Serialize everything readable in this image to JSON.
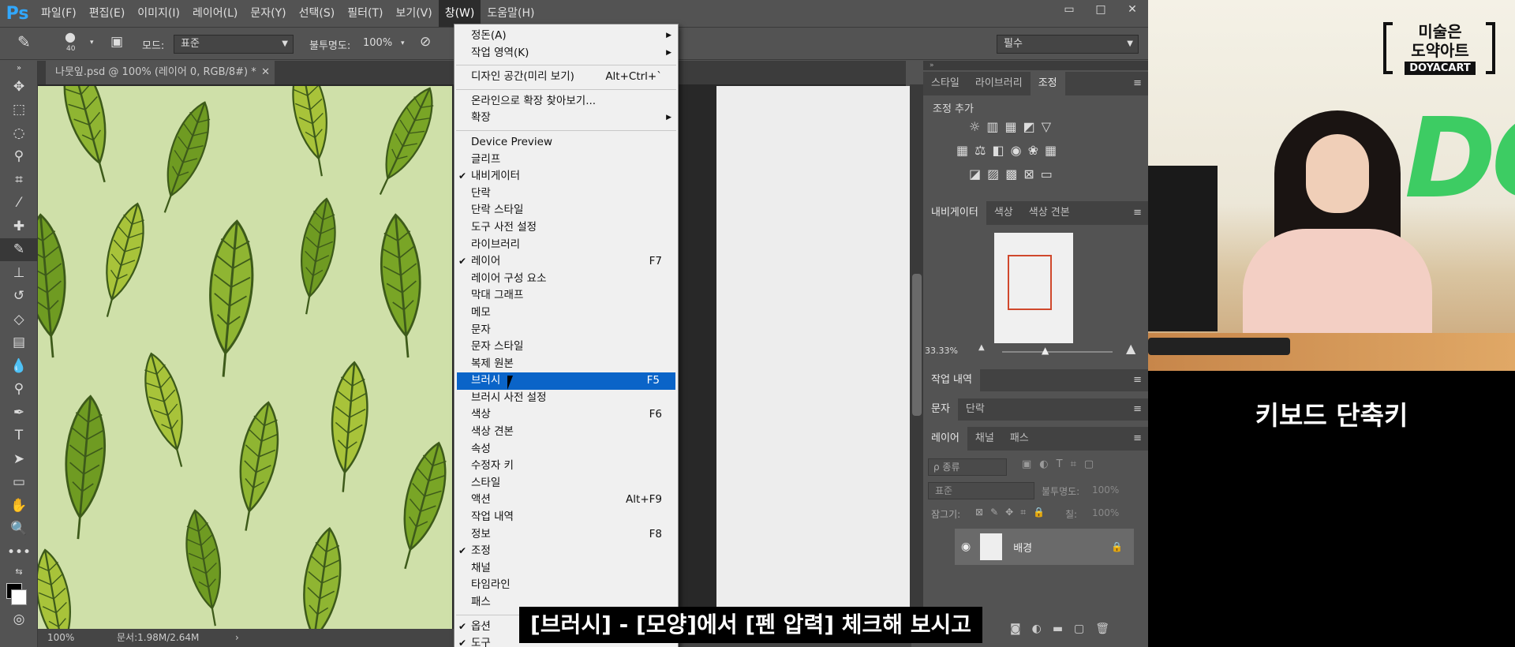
{
  "menubar": {
    "logo": "Ps",
    "items": [
      "파일(F)",
      "편집(E)",
      "이미지(I)",
      "레이어(L)",
      "문자(Y)",
      "선택(S)",
      "필터(T)",
      "보기(V)",
      "창(W)",
      "도움말(H)"
    ],
    "active_index": 8,
    "win_buttons": [
      "▭",
      "□",
      "✕"
    ]
  },
  "options": {
    "brush_size": "40",
    "mode_label": "모드:",
    "mode_value": "표준",
    "opacity_label": "불투명도:",
    "opacity_value": "100%",
    "workspace": "필수"
  },
  "document_tab": {
    "title": "나뭇잎.psd @ 100% (레이어 0, RGB/8#) *",
    "close": "✕"
  },
  "window_menu": {
    "items": [
      {
        "label": "정돈(A)",
        "submenu": true
      },
      {
        "label": "작업 영역(K)",
        "submenu": true
      },
      {
        "separator": true
      },
      {
        "label": "디자인 공간(미리 보기)",
        "shortcut": "Alt+Ctrl+`"
      },
      {
        "separator": true
      },
      {
        "label": "온라인으로 확장 찾아보기..."
      },
      {
        "label": "확장",
        "submenu": true
      },
      {
        "separator": true
      },
      {
        "label": "Device Preview"
      },
      {
        "label": "글리프"
      },
      {
        "label": "내비게이터",
        "checked": true
      },
      {
        "label": "단락"
      },
      {
        "label": "단락 스타일"
      },
      {
        "label": "도구 사전 설정"
      },
      {
        "label": "라이브러리"
      },
      {
        "label": "레이어",
        "checked": true,
        "shortcut": "F7"
      },
      {
        "label": "레이어 구성 요소"
      },
      {
        "label": "막대 그래프"
      },
      {
        "label": "메모"
      },
      {
        "label": "문자"
      },
      {
        "label": "문자 스타일"
      },
      {
        "label": "복제 원본"
      },
      {
        "label": "브러시",
        "shortcut": "F5",
        "highlighted": true
      },
      {
        "label": "브러시 사전 설정"
      },
      {
        "label": "색상",
        "shortcut": "F6"
      },
      {
        "label": "색상 견본"
      },
      {
        "label": "속성"
      },
      {
        "label": "수정자 키"
      },
      {
        "label": "스타일"
      },
      {
        "label": "액션",
        "shortcut": "Alt+F9"
      },
      {
        "label": "작업 내역"
      },
      {
        "label": "정보",
        "shortcut": "F8"
      },
      {
        "label": "조정",
        "checked": true
      },
      {
        "label": "채널"
      },
      {
        "label": "타임라인"
      },
      {
        "label": "패스"
      },
      {
        "separator": true
      },
      {
        "label": "옵션",
        "checked": true
      },
      {
        "label": "도구",
        "checked": true
      }
    ]
  },
  "status": {
    "zoom": "100%",
    "doc": "문서:1.98M/2.64M"
  },
  "panels": {
    "top_tabs": [
      "스타일",
      "라이브러리",
      "조정"
    ],
    "adj_title": "조정 추가",
    "nav_tabs": [
      "내비게이터",
      "색상",
      "색상 견본"
    ],
    "nav_zoom": "33.33%",
    "history_tab": "작업 내역",
    "type_tabs": [
      "문자",
      "단락"
    ],
    "layer_tabs": [
      "레이어",
      "채널",
      "패스"
    ],
    "layer_kind": "ρ 종류",
    "blend_mode": "표준",
    "opacity_label": "불투명도:",
    "opacity_value": "100%",
    "lock_label": "잠그기:",
    "fill_label": "칠:",
    "fill_value": "100%",
    "layer_name": "배경"
  },
  "sidebar": {
    "brand_line1": "미술은",
    "brand_line2": "도약아트",
    "brand_badge": "DOYACART",
    "caption": "키보드 단축키"
  },
  "subtitle": "[브러시] - [모양]에서 [펜 압력] 체크해 보시고"
}
